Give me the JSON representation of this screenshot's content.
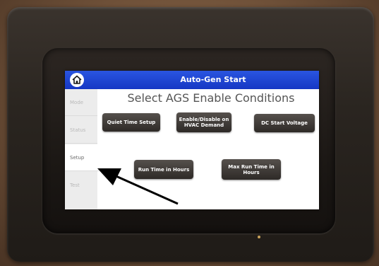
{
  "header": {
    "title": "Auto-Gen Start"
  },
  "page": {
    "heading": "Select AGS Enable Conditions"
  },
  "sidebar": {
    "items": [
      {
        "label": "Mode"
      },
      {
        "label": "Status"
      },
      {
        "label": "Setup",
        "active": true
      },
      {
        "label": "Test"
      }
    ]
  },
  "buttons": {
    "quiet_time": "Quiet Time Setup",
    "hvac_demand": "Enable/Disable on HVAC Demand",
    "dc_start_voltage": "DC Start Voltage",
    "run_time_hours": "Run Time in Hours",
    "max_run_time": "Max Run Time in Hours"
  },
  "icons": {
    "home": "home-icon",
    "pointer": "arrow-pointer"
  },
  "colors": {
    "titlebar": "#1f44d6",
    "button": "#3a3532",
    "screen_bg": "#ffffff"
  }
}
